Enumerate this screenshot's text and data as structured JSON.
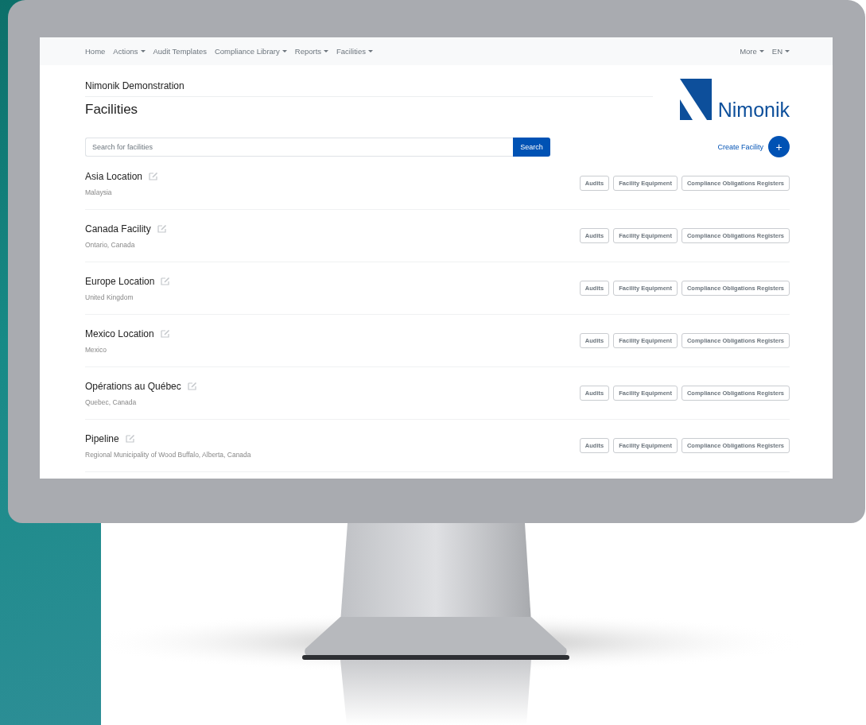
{
  "nav": {
    "left": [
      {
        "label": "Home",
        "dropdown": false
      },
      {
        "label": "Actions",
        "dropdown": true
      },
      {
        "label": "Audit Templates",
        "dropdown": false
      },
      {
        "label": "Compliance Library",
        "dropdown": true
      },
      {
        "label": "Reports",
        "dropdown": true
      },
      {
        "label": "Facilities",
        "dropdown": true
      }
    ],
    "right": [
      {
        "label": "More",
        "dropdown": true
      },
      {
        "label": "EN",
        "dropdown": true
      }
    ]
  },
  "organization": "Nimonik Demonstration",
  "title": "Facilities",
  "logo": {
    "text": "Nimonik"
  },
  "search": {
    "placeholder": "Search for facilities",
    "button": "Search"
  },
  "create": {
    "label": "Create Facility",
    "button": "+"
  },
  "facilities": [
    {
      "name": "Asia Location",
      "location": "Malaysia",
      "actions": [
        "Audits",
        "Facility Equipment",
        "Compliance Obligations Registers"
      ]
    },
    {
      "name": "Canada Facility",
      "location": "Ontario, Canada",
      "actions": [
        "Audits",
        "Facility Equipment",
        "Compliance Obligations Registers"
      ]
    },
    {
      "name": "Europe Location",
      "location": "United Kingdom",
      "actions": [
        "Audits",
        "Facility Equipment",
        "Compliance Obligations Registers"
      ]
    },
    {
      "name": "Mexico Location",
      "location": "Mexico",
      "actions": [
        "Audits",
        "Facility Equipment",
        "Compliance Obligations Registers"
      ]
    },
    {
      "name": "Opérations au Québec",
      "location": "Quebec, Canada",
      "actions": [
        "Audits",
        "Facility Equipment",
        "Compliance Obligations Registers"
      ]
    },
    {
      "name": "Pipeline",
      "location": "Regional Municipality of Wood Buffalo, Alberta, Canada",
      "actions": [
        "Audits",
        "Facility Equipment",
        "Compliance Obligations Registers"
      ]
    }
  ]
}
